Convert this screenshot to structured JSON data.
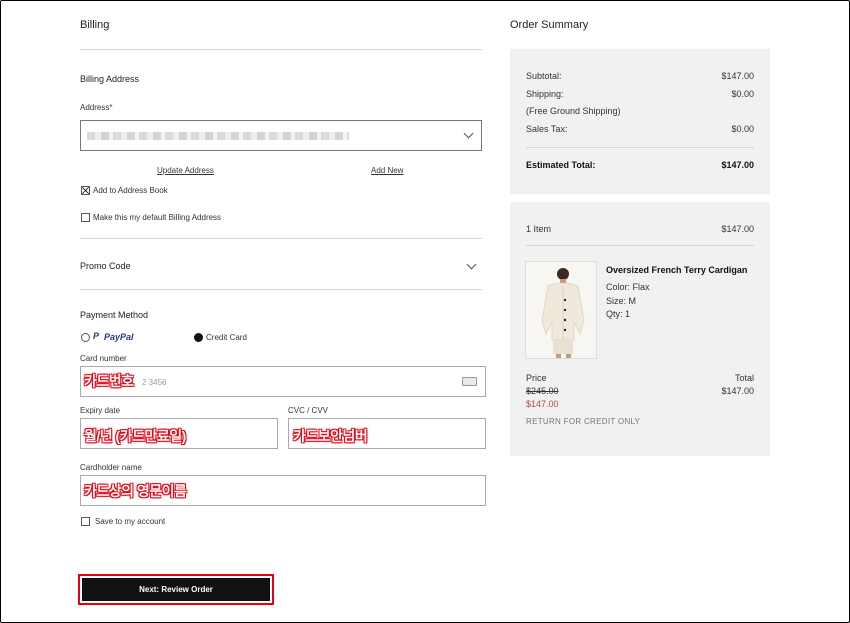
{
  "billing": {
    "title": "Billing",
    "billing_address_title": "Billing Address",
    "address_label": "Address*",
    "update_address": "Update Address",
    "add_new": "Add New",
    "add_to_address_book": "Add to Address Book",
    "add_to_address_book_checked": true,
    "default_billing": "Make this my default Billing Address",
    "default_billing_checked": false
  },
  "promo": {
    "title": "Promo Code"
  },
  "payment": {
    "title": "Payment Method",
    "paypal_label": "PayPal",
    "credit_card_label": "Credit Card",
    "selected": "Credit Card",
    "card_number_label": "Card number",
    "card_number_annotation": "카드번호",
    "card_number_placeholder_tail": "2 3456",
    "expiry_label": "Expiry date",
    "expiry_annotation": "월/년 (카드만료일)",
    "cvc_label": "CVC / CVV",
    "cvc_annotation": "카드보안넘버",
    "cardholder_label": "Cardholder name",
    "cardholder_annotation": "카드상의 영문이름",
    "save_label": "Save to my account"
  },
  "cta": {
    "label": "Next: Review Order"
  },
  "summary": {
    "title": "Order Summary",
    "subtotal_label": "Subtotal:",
    "subtotal_value": "$147.00",
    "shipping_label": "Shipping:",
    "shipping_value": "$0.00",
    "shipping_note": "(Free Ground Shipping)",
    "tax_label": "Sales Tax:",
    "tax_value": "$0.00",
    "estimated_label": "Estimated Total:",
    "estimated_value": "$147.00"
  },
  "cart": {
    "count_label": "1 Item",
    "count_total": "$147.00",
    "item_name": "Oversized French Terry Cardigan",
    "color": "Color: Flax",
    "size": "Size: M",
    "qty": "Qty: 1",
    "price_label": "Price",
    "total_label": "Total",
    "original_price": "$245.00",
    "sale_price": "$147.00",
    "line_total": "$147.00",
    "return_note": "RETURN FOR CREDIT ONLY"
  }
}
